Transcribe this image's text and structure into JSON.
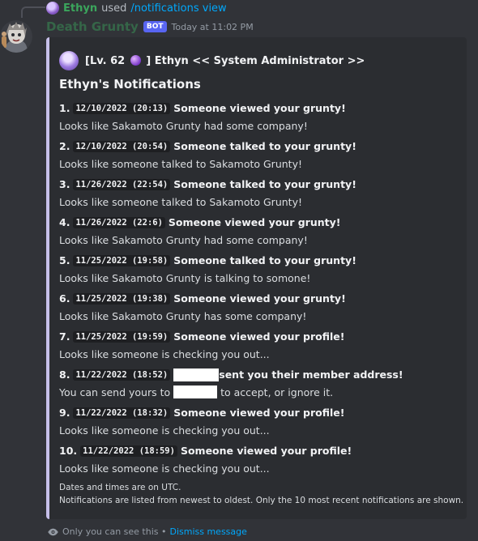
{
  "interaction": {
    "user": "Ethyn",
    "used_text": "used",
    "command": "/notifications view"
  },
  "author": {
    "name": "Death Grunty",
    "badge": "BOT",
    "timestamp": "Today at 11:02 PM"
  },
  "embed": {
    "accent_color": "#c6bfe9",
    "author_prefix": "[Lv. 62",
    "author_suffix": "] Ethyn << System Administrator >>",
    "title": "Ethyn's Notifications",
    "entries": [
      {
        "num": "1.",
        "time": "12/10/2022 (20:13)",
        "head": "Someone viewed your grunty!",
        "body": "Looks like Sakamoto Grunty had some company!"
      },
      {
        "num": "2.",
        "time": "12/10/2022 (20:54)",
        "head": "Someone talked to your grunty!",
        "body": "Looks like someone talked to Sakamoto Grunty!"
      },
      {
        "num": "3.",
        "time": "11/26/2022 (22:54)",
        "head": "Someone talked to your grunty!",
        "body": "Looks like someone talked to Sakamoto Grunty!"
      },
      {
        "num": "4.",
        "time": "11/26/2022 (22:6)",
        "head": "Someone viewed your grunty!",
        "body": "Looks like Sakamoto Grunty had some company!"
      },
      {
        "num": "5.",
        "time": "11/25/2022 (19:58)",
        "head": "Someone talked to your grunty!",
        "body": "Looks like Sakamoto Grunty is talking to somone!"
      },
      {
        "num": "6.",
        "time": "11/25/2022 (19:38)",
        "head": "Someone viewed your grunty!",
        "body": "Looks like Sakamoto Grunty has some company!"
      },
      {
        "num": "7.",
        "time": "11/25/2022 (19:59)",
        "head": "Someone viewed your profile!",
        "body": "Looks like someone is checking you out..."
      },
      {
        "num": "8.",
        "time": "11/22/2022 (18:52)",
        "head": "sent you their member address!",
        "body_pre": "You can send yours to",
        "body_post": "to accept, or ignore it."
      },
      {
        "num": "9.",
        "time": "11/22/2022 (18:32)",
        "head": "Someone viewed your profile!",
        "body": "Looks like someone is checking you out..."
      },
      {
        "num": "10.",
        "time": "11/22/2022 (18:59)",
        "head": "Someone viewed your profile!",
        "body": "Looks like someone is checking you out..."
      }
    ],
    "footer_line1": "Dates and times are on UTC.",
    "footer_line2": "Notifications are listed from newest to oldest. Only the 10 most recent notifications are shown."
  },
  "ephemeral": {
    "text": "Only you can see this •",
    "dismiss": "Dismiss message"
  }
}
